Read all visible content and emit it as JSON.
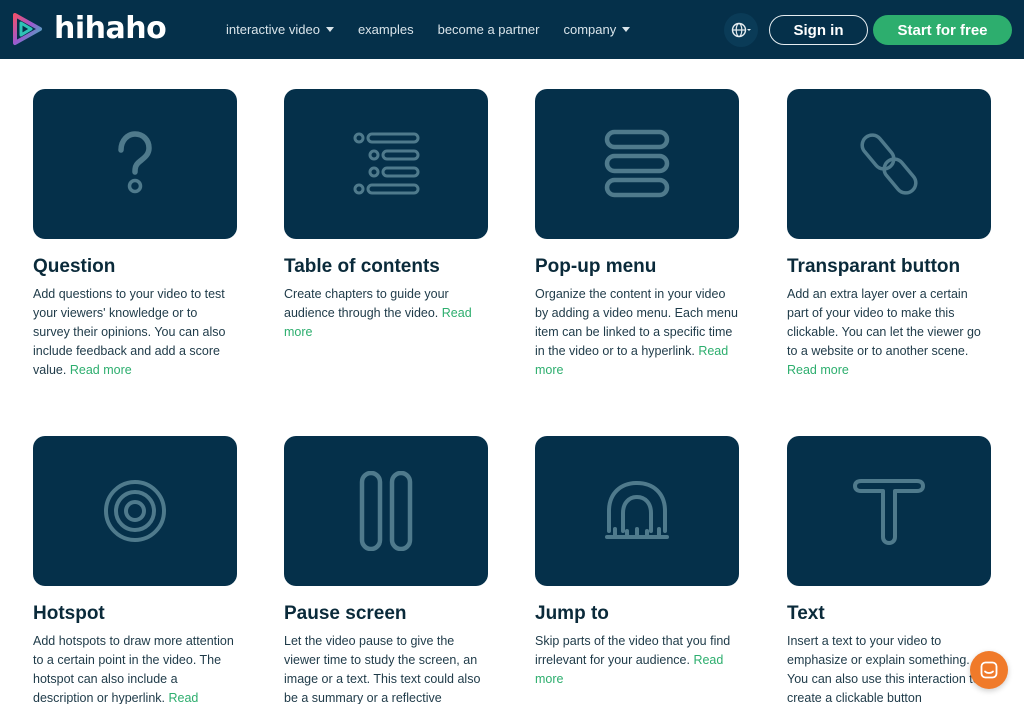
{
  "header": {
    "brand": "hihaho",
    "nav": [
      {
        "label": "interactive video",
        "dropdown": true
      },
      {
        "label": "examples",
        "dropdown": false
      },
      {
        "label": "become a partner",
        "dropdown": false
      },
      {
        "label": "company",
        "dropdown": true
      }
    ],
    "sign_in": "Sign in",
    "start": "Start for free"
  },
  "cards": [
    {
      "icon": "question-icon",
      "title": "Question",
      "desc": "Add questions to your video to test your viewers' knowledge or to survey their opinions. You can also include feedback and add a score value.",
      "read_more": "Read more"
    },
    {
      "icon": "table-of-contents-icon",
      "title": "Table of contents",
      "desc": "Create chapters to guide your audience through the video.",
      "read_more": "Read more"
    },
    {
      "icon": "popup-menu-icon",
      "title": "Pop-up menu",
      "desc": "Organize the content in your video by adding a video menu. Each menu item can be linked to a specific time in the video or to a hyperlink.",
      "read_more": "Read more"
    },
    {
      "icon": "link-icon",
      "title": "Transparant button",
      "desc": "Add an extra layer over a certain part of your video to make this clickable. You can let the viewer go to a website or to another scene.",
      "read_more": "Read more"
    },
    {
      "icon": "target-icon",
      "title": "Hotspot",
      "desc": "Add hotspots to draw more attention to a certain point in the video. The hotspot can also include a description or hyperlink.",
      "read_more": "Read"
    },
    {
      "icon": "pause-icon",
      "title": "Pause screen",
      "desc": "Let the video pause to give the viewer time to study the screen, an image or a text. This text could also be a summary or a reflective",
      "read_more": ""
    },
    {
      "icon": "jump-icon",
      "title": "Jump to",
      "desc": "Skip parts of the video that you find irrelevant for your audience.",
      "read_more": "Read more"
    },
    {
      "icon": "text-icon",
      "title": "Text",
      "desc": "Insert a text to your video to emphasize or explain something. You can also use this interaction to create a clickable button",
      "read_more": ""
    }
  ],
  "colors": {
    "nav_bg": "#05304a",
    "accent": "#2dae6e",
    "tile_bg": "#05304a",
    "icon_stroke": "#4f7a8c",
    "chat": "#f07a2a"
  }
}
